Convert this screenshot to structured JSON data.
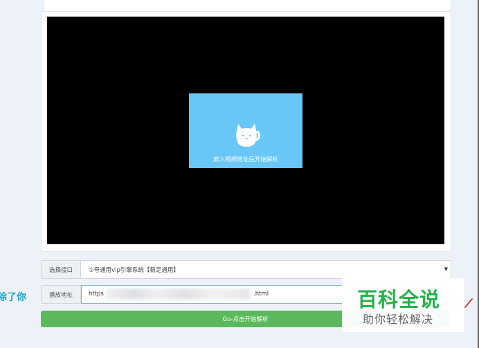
{
  "player": {
    "placeholder_text": "放入视频地址后开始解析",
    "background_color": "#000000",
    "placeholder_color": "#68c7f7"
  },
  "interface_row": {
    "label": "选择接口",
    "selected": "①号通用vip引擎系统【稳定通用】"
  },
  "url_row": {
    "label": "播放地址",
    "value_start": "https",
    "value_end": ".html"
  },
  "go_button": {
    "label": "Go-点击开始解析",
    "color": "#5cb85c"
  },
  "left_text": "除了你",
  "watermark": {
    "title": "百科全说",
    "subtitle": "助你轻松解决",
    "title_color": "#24b24a"
  }
}
